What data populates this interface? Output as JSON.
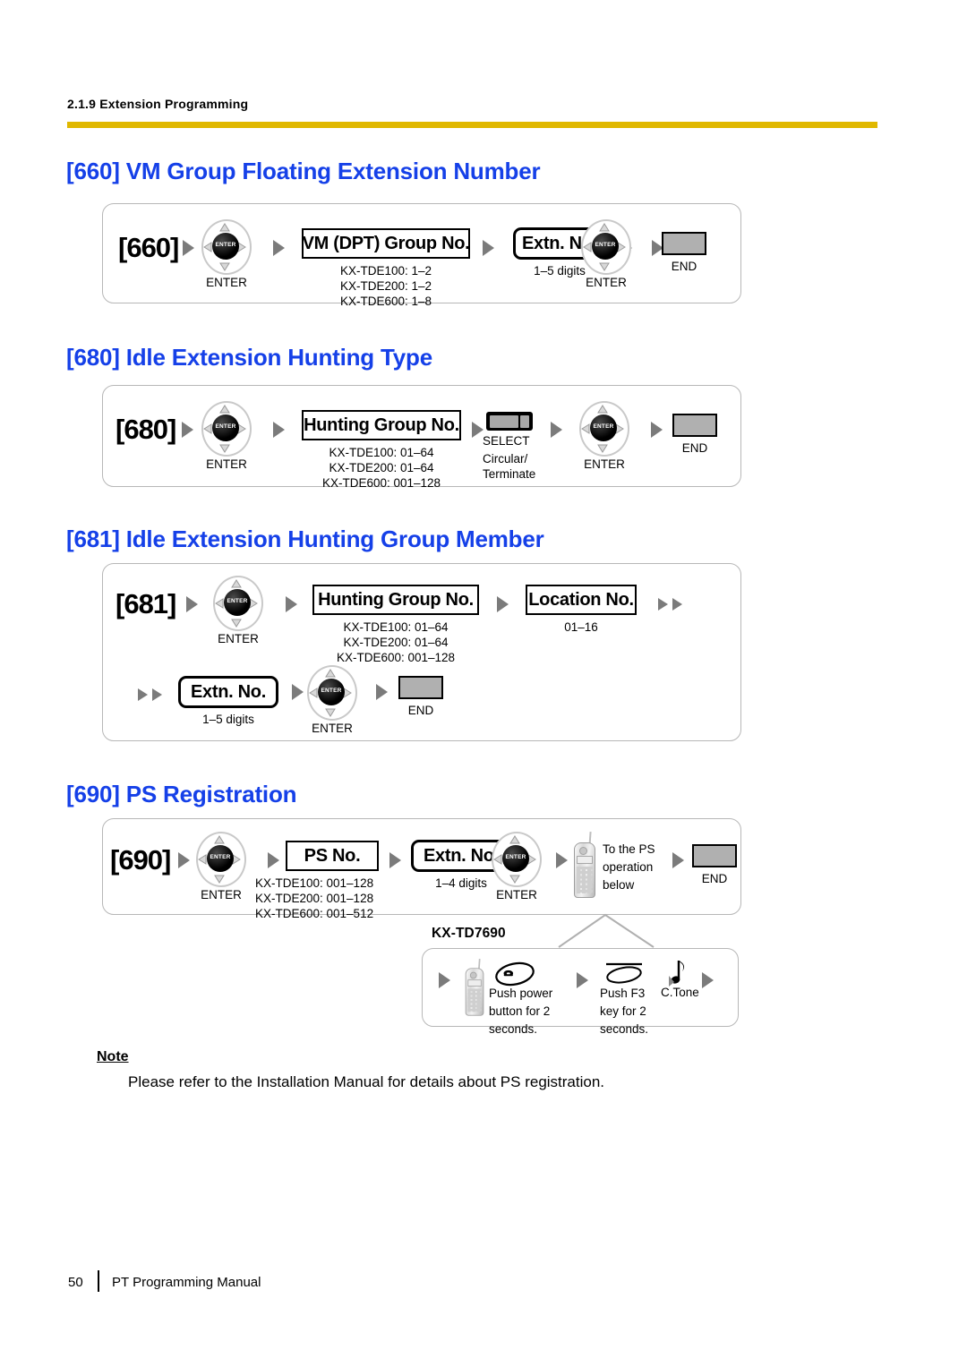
{
  "header": {
    "breadcrumb": "2.1.9 Extension Programming",
    "rule_color": "#E0B800"
  },
  "heading_color": "#1540E8",
  "sections": [
    {
      "id": "660",
      "title": "[660] VM Group Floating Extension Number",
      "code": "[660]",
      "enter1_label": "ENTER",
      "field1_label": "VM (DPT) Group No.",
      "field1_caption": "KX-TDE100: 1–2\nKX-TDE200: 1–2\nKX-TDE600: 1–8",
      "field2_label": "Extn. No.",
      "field2_caption": "1–5 digits",
      "enter2_label": "ENTER",
      "end_label": "END"
    },
    {
      "id": "680",
      "title": "[680] Idle Extension Hunting Type",
      "code": "[680]",
      "enter1_label": "ENTER",
      "field1_label": "Hunting Group No.",
      "field1_caption": "KX-TDE100: 01–64\nKX-TDE200: 01–64\nKX-TDE600: 001–128",
      "select_label": "SELECT",
      "select_caption": "Circular/\nTerminate",
      "enter2_label": "ENTER",
      "end_label": "END"
    },
    {
      "id": "681",
      "title": "[681] Idle Extension Hunting Group Member",
      "code": "[681]",
      "enter1_label": "ENTER",
      "field1_label": "Hunting Group No.",
      "field1_caption": "KX-TDE100: 01–64\nKX-TDE200: 01–64\nKX-TDE600: 001–128",
      "field2_label": "Location No.",
      "field2_caption": "01–16",
      "field3_label": "Extn. No.",
      "field3_caption": "1–5 digits",
      "enter2_label": "ENTER",
      "end_label": "END"
    },
    {
      "id": "690",
      "title": "[690] PS Registration",
      "code": "[690]",
      "enter1_label": "ENTER",
      "field1_label": "PS No.",
      "field1_caption": "KX-TDE100: 001–128\nKX-TDE200: 001–128\nKX-TDE600: 001–512",
      "field2_label": "Extn. No.",
      "field2_caption": "1–4 digits",
      "enter2_label": "ENTER",
      "ps_caption": "To the PS\noperation\nbelow",
      "end_label": "END"
    }
  ],
  "subdiagram": {
    "title": "KX-TD7690",
    "step1_caption": "Push power\nbutton for 2\nseconds.",
    "step2_caption": "Push F3\nkey for 2\nseconds.",
    "step3_caption": "C.Tone"
  },
  "note": {
    "heading": "Note",
    "body": "Please refer to the Installation Manual for details about PS registration."
  },
  "footer": {
    "page_number": "50",
    "manual_title": "PT Programming Manual"
  }
}
